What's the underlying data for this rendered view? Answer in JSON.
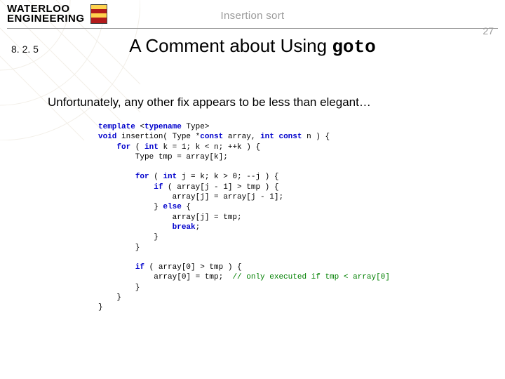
{
  "logo": {
    "line1": "WATERLOO",
    "line2": "ENGINEERING"
  },
  "topic": "Insertion sort",
  "page_number": "27",
  "section_number": "8. 2. 5",
  "title_prefix": "A Comment about Using ",
  "title_kw": "goto",
  "body": "Unfortunately, any other fix appears to be less than elegant…",
  "code": {
    "l01a": "template",
    "l01b": " <",
    "l01c": "typename",
    "l01d": " Type>",
    "l02a": "void",
    "l02b": " insertion( Type *",
    "l02c": "const",
    "l02d": " array, ",
    "l02e": "int const",
    "l02f": " n ) {",
    "l03a": "    ",
    "l03b": "for",
    "l03c": " ( ",
    "l03d": "int",
    "l03e": " k = 1; k < n; ++k ) {",
    "l04": "        Type tmp = array[k];",
    "l05": "",
    "l06a": "        ",
    "l06b": "for",
    "l06c": " ( ",
    "l06d": "int",
    "l06e": " j = k; k > 0; --j ) {",
    "l07a": "            ",
    "l07b": "if",
    "l07c": " ( array[j - 1] > tmp ) {",
    "l08": "                array[j] = array[j - 1];",
    "l09a": "            } ",
    "l09b": "else",
    "l09c": " {",
    "l10": "                array[j] = tmp;",
    "l11a": "                ",
    "l11b": "break",
    "l11c": ";",
    "l12": "            }",
    "l13": "        }",
    "l14": "",
    "l15a": "        ",
    "l15b": "if",
    "l15c": " ( array[0] > tmp ) {",
    "l16a": "            array[0] = tmp;  ",
    "l16b": "// only executed if tmp < array[0]",
    "l17": "        }",
    "l18": "    }",
    "l19": "}"
  }
}
